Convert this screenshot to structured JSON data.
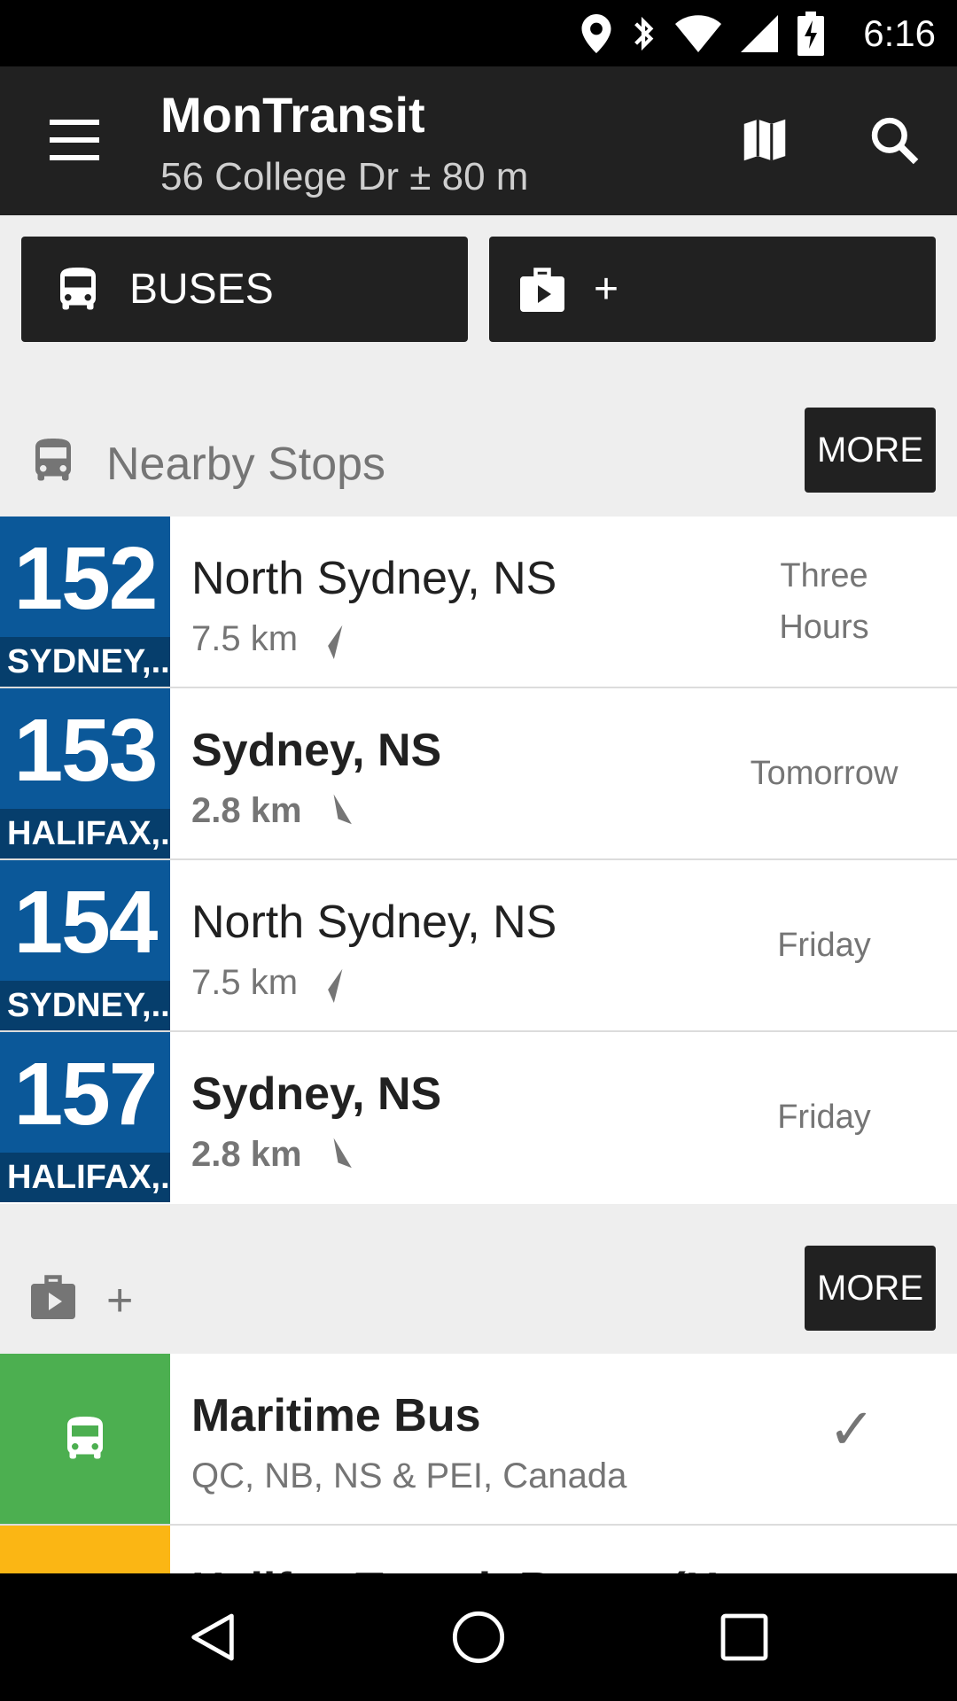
{
  "status_bar": {
    "time": "6:16",
    "icons": [
      "location-icon",
      "bluetooth-icon",
      "wifi-icon",
      "cell-signal-icon",
      "battery-charging-icon"
    ]
  },
  "toolbar": {
    "title": "MonTransit",
    "subtitle": "56 College Dr ± 80 m",
    "menu_icon": "hamburger-menu-icon",
    "map_icon": "map-icon",
    "search_icon": "search-icon"
  },
  "quick_buttons": {
    "buses_label": "BUSES",
    "plus_label": "+"
  },
  "nearby": {
    "title": "Nearby Stops",
    "more_label": "MORE",
    "stops": [
      {
        "route": "152",
        "destination": "SYDNEY,..",
        "name": "North Sydney, NS",
        "distance": "7.5 km",
        "when": "Three Hours",
        "bold": false
      },
      {
        "route": "153",
        "destination": "HALIFAX,..",
        "name": "Sydney, NS",
        "distance": "2.8 km",
        "when": "Tomorrow",
        "bold": true
      },
      {
        "route": "154",
        "destination": "SYDNEY,..",
        "name": "North Sydney, NS",
        "distance": "7.5 km",
        "when": "Friday",
        "bold": false
      },
      {
        "route": "157",
        "destination": "HALIFAX,..",
        "name": "Sydney, NS",
        "distance": "2.8 km",
        "when": "Friday",
        "bold": true
      }
    ]
  },
  "agencies_section": {
    "title": "+",
    "more_label": "MORE",
    "agencies": [
      {
        "name": "Maritime Bus",
        "sub": "QC, NB, NS & PEI, Canada",
        "check": "✓",
        "color": "#4caf50"
      },
      {
        "name": "Halifax Transit Buses (H...",
        "color": "#fbb614"
      }
    ]
  },
  "colors": {
    "route_bg": "#0b5899",
    "route_dest_bg": "#063e6c",
    "toolbar_bg": "#212121",
    "maritime_green": "#4caf50",
    "halifax_yellow": "#fbb614"
  }
}
